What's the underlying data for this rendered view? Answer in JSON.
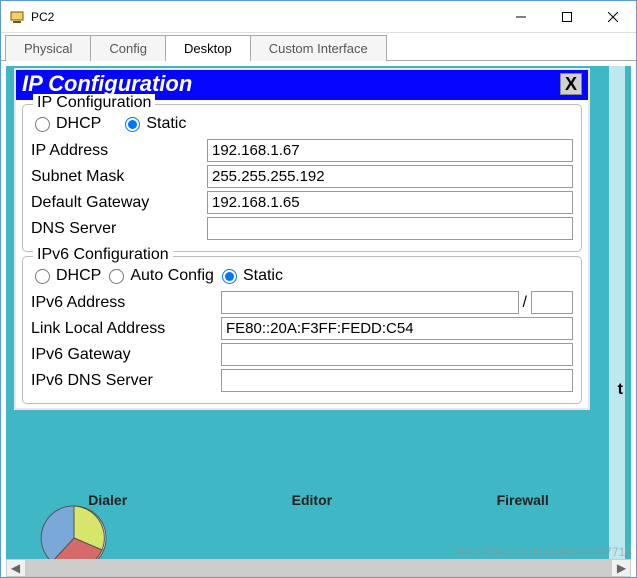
{
  "window": {
    "title": "PC2"
  },
  "tabs": [
    {
      "label": "Physical"
    },
    {
      "label": "Config"
    },
    {
      "label": "Desktop",
      "active": true
    },
    {
      "label": "Custom Interface"
    }
  ],
  "dialog": {
    "title": "IP Configuration",
    "close": "X",
    "ipv4": {
      "legend": "IP Configuration",
      "dhcp": "DHCP",
      "static": "Static",
      "ip_label": "IP Address",
      "ip": "192.168.1.67",
      "mask_label": "Subnet Mask",
      "mask": "255.255.255.192",
      "gw_label": "Default Gateway",
      "gw": "192.168.1.65",
      "dns_label": "DNS Server",
      "dns": ""
    },
    "ipv6": {
      "legend": "IPv6 Configuration",
      "dhcp": "DHCP",
      "auto": "Auto Config",
      "static": "Static",
      "addr_label": "IPv6 Address",
      "addr": "",
      "slash": "/",
      "prefix": "",
      "ll_label": "Link Local Address",
      "ll": "FE80::20A:F3FF:FEDD:C54",
      "gw_label": "IPv6 Gateway",
      "gw": "",
      "dns_label": "IPv6 DNS Server",
      "dns": ""
    }
  },
  "desktop": {
    "labels": [
      "Dialer",
      "Editor",
      "Firewall"
    ],
    "hilite": "t"
  },
  "watermark": "https://blog.csdn.net/u014797713"
}
